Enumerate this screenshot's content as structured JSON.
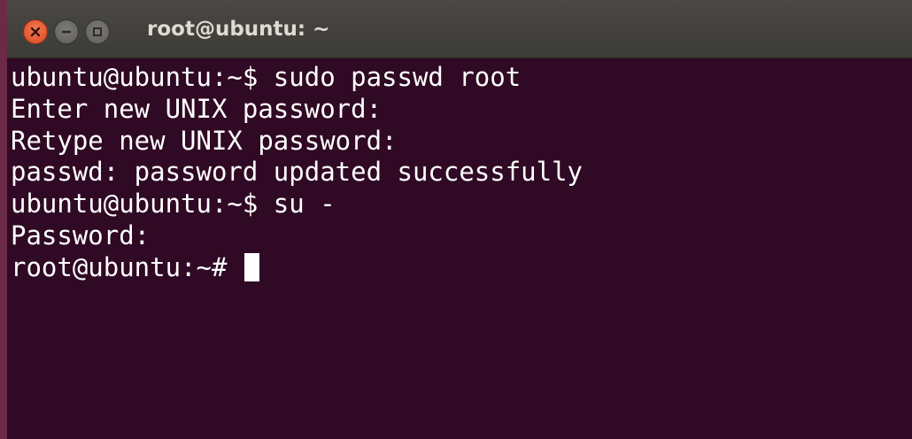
{
  "window": {
    "title": "root@ubuntu: ~",
    "buttons": {
      "close": "close-icon",
      "minimize": "minimize-icon",
      "maximize": "maximize-icon"
    }
  },
  "terminal": {
    "lines": [
      "ubuntu@ubuntu:~$ sudo passwd root",
      "Enter new UNIX password:",
      "Retype new UNIX password:",
      "passwd: password updated successfully",
      "ubuntu@ubuntu:~$ su -",
      "Password:",
      "root@ubuntu:~# "
    ]
  },
  "colors": {
    "terminal_background": "#300a24",
    "terminal_text": "#ffffff",
    "titlebar": "#3c3b37",
    "close_button": "#e95420"
  }
}
